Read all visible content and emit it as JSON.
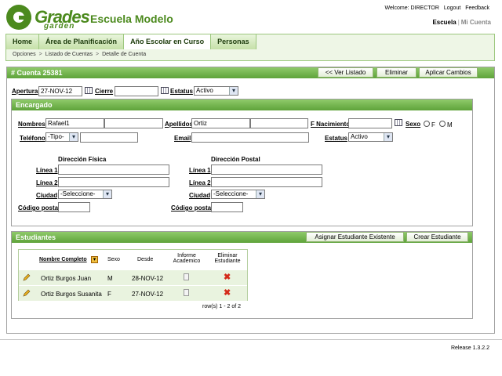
{
  "header": {
    "logo_word": "Grades",
    "logo_sub": "garden",
    "school": "Escuela Modelo",
    "welcome": "Welcome: DIRECTOR",
    "logout": "Logout",
    "feedback": "Feedback",
    "escuela": "Escuela",
    "sep": "|",
    "mi_cuenta": "Mi Cuenta"
  },
  "nav": {
    "tabs": [
      "Home",
      "Área de Planificación",
      "Año Escolar en Curso",
      "Personas"
    ],
    "active_tab": 2,
    "breadcrumbs": [
      "Opciones",
      "Listado de Cuentas",
      "Detalle de Cuenta"
    ],
    "crumb_sep": ">"
  },
  "cuenta": {
    "title": "# Cuenta 25381",
    "buttons": [
      "<< Ver Listado",
      "Eliminar",
      "Aplicar Cambios"
    ],
    "apertura_label": "Apertura",
    "apertura": "27-NOV-12",
    "cierre_label": "Cierre",
    "cierre": "",
    "estatus_label": "Estatus",
    "estatus": "Activo"
  },
  "encargado": {
    "title": "Encargado",
    "nombres_label": "Nombres",
    "nombres": "Rafael1",
    "nombres2": "",
    "apellidos_label": "Apellidos",
    "apellidos": "Ortiz",
    "apellidos2": "",
    "fnac_label": "F Nacimiento",
    "fnac": "",
    "sexo_label": "Sexo",
    "sexo_f": "F",
    "sexo_m": "M",
    "telefono_label": "Teléfono",
    "telefono_tipo": "-Tipo-",
    "telefono": "",
    "email_label": "Email",
    "email": "",
    "estatus_label": "Estatus",
    "estatus": "Activo",
    "dir_fisica": "Dirección Física",
    "dir_postal": "Dirección Postal",
    "linea1": "Línea 1",
    "linea2": "Línea 2",
    "ciudad": "Ciudad",
    "ciudad_sel": "-Seleccione-",
    "codigo": "Código postal"
  },
  "estudiantes": {
    "title": "Estudiantes",
    "buttons": [
      "Asignar Estudiante Existente",
      "Crear Estudiante"
    ],
    "columns": [
      "Nombre Completo",
      "Sexo",
      "Desde",
      "Informe Academico",
      "Eliminar Estudiante"
    ],
    "rows": [
      {
        "name": "Ortiz Burgos Juan",
        "sexo": "M",
        "desde": "28-NOV-12"
      },
      {
        "name": "Ortiz Burgos Susanita",
        "sexo": "F",
        "desde": "27-NOV-12"
      }
    ],
    "pager": "row(s) 1 - 2 of 2"
  },
  "footer": {
    "release": "Release 1.3.2.2"
  },
  "colors": {
    "brand_green": "#4c8a1e",
    "panel_header": "#6fb048",
    "delete_red": "#d42a1a"
  },
  "icons": [
    "calendar-icon",
    "pencil-icon",
    "document-icon",
    "delete-x-icon",
    "sort-dropdown-icon",
    "chevron-down-icon"
  ]
}
